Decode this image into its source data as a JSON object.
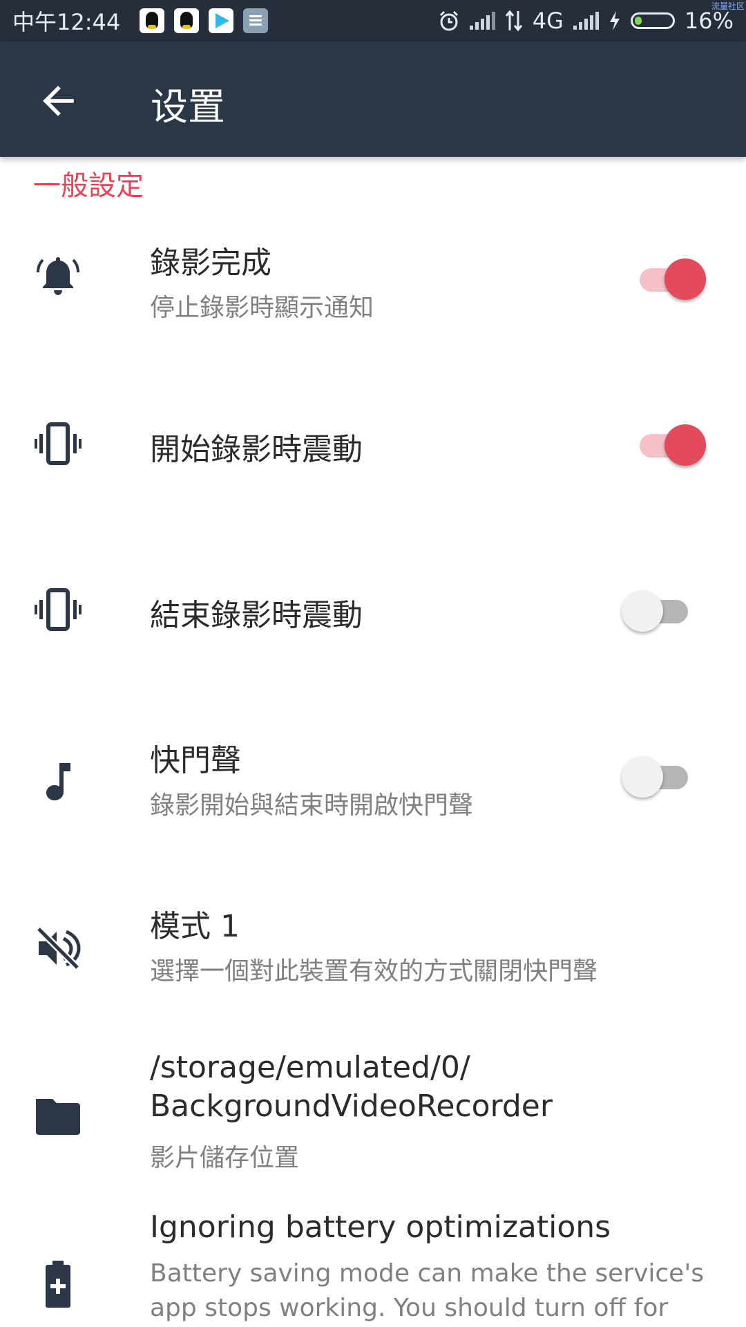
{
  "status_bar": {
    "time": "中午12:44",
    "network": "4G",
    "battery_percent": "16%",
    "corner_label": "流量社区",
    "notification_icons": [
      "qq-icon",
      "qq-icon",
      "video-app-icon",
      "document-icon"
    ],
    "system_icons": [
      "alarm-icon",
      "signal-icon",
      "data-arrows-icon",
      "signal-icon",
      "charging-icon",
      "battery-icon"
    ]
  },
  "app_bar": {
    "back_icon": "arrow-left-icon",
    "title": "设置"
  },
  "section": {
    "title": "一般設定"
  },
  "settings": {
    "record_complete": {
      "icon": "bell-icon",
      "title": "錄影完成",
      "summary": "停止錄影時顯示通知",
      "enabled": true
    },
    "vibrate_start": {
      "icon": "vibrate-icon",
      "title": "開始錄影時震動",
      "enabled": true
    },
    "vibrate_end": {
      "icon": "vibrate-icon",
      "title": "結束錄影時震動",
      "enabled": false
    },
    "shutter_sound": {
      "icon": "music-note-icon",
      "title": "快門聲",
      "summary": "錄影開始與結束時開啟快門聲",
      "enabled": false
    },
    "mode": {
      "icon": "volume-off-icon",
      "title": "模式 1",
      "summary": "選擇一個對此裝置有效的方式關閉快門聲"
    },
    "storage": {
      "icon": "folder-icon",
      "title_line1": "/storage/emulated/0/",
      "title_line2": "BackgroundVideoRecorder",
      "summary": "影片儲存位置"
    },
    "battery_opt": {
      "icon": "battery-plus-icon",
      "title": "Ignoring battery optimizations",
      "summary_line1": "Battery saving mode can make the service's",
      "summary_line2": "app stops working. You should turn off for"
    }
  },
  "colors": {
    "accent": "#e34a5c",
    "section_header": "#e0455a",
    "app_bar": "#2b3646",
    "status_bar": "#252e3a"
  }
}
